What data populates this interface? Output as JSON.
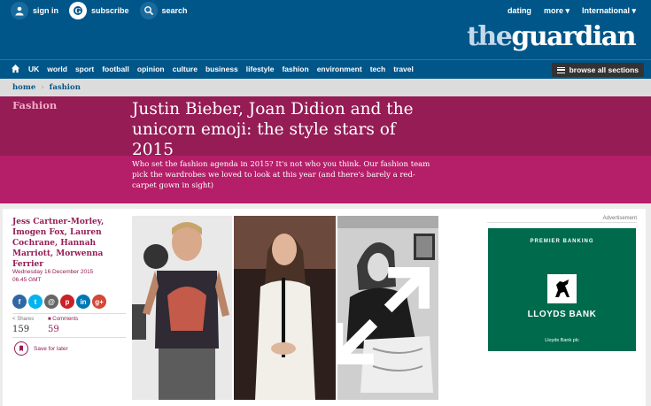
{
  "header": {
    "top_links": [
      {
        "label": "sign in",
        "icon": "user-icon"
      },
      {
        "label": "subscribe",
        "icon": "guardian-icon"
      },
      {
        "label": "search",
        "icon": "search-icon"
      }
    ],
    "right_links": [
      "dating",
      "more ▾",
      "International ▾"
    ],
    "logo": {
      "the": "the",
      "brand": "guardian"
    },
    "brand_color": "#005689"
  },
  "nav": {
    "items": [
      "UK",
      "world",
      "sport",
      "football",
      "opinion",
      "culture",
      "business",
      "lifestyle",
      "fashion",
      "environment",
      "tech",
      "travel"
    ],
    "browse_label": "browse all sections"
  },
  "breadcrumb": {
    "items": [
      "home",
      "fashion"
    ],
    "separator": "›"
  },
  "article": {
    "section": "Fashion",
    "headline": "Justin Bieber, Joan Didion and the unicorn emoji: the style stars of 2015",
    "standfirst": "Who set the fashion agenda in 2015? It's not who you think. Our fashion team pick the wardrobes we loved to look at this year (and there's barely a red-carpet gown in sight)",
    "byline": "Jess Cartner-Morley, Imogen Fox, Lauren Cochrane, Hannah Marriott, Morwenna Ferrier",
    "date": "Wednesday 16 December 2015",
    "time": "06.45 GMT",
    "share_buttons": [
      {
        "label": "f",
        "icon": "facebook-icon",
        "color": "#3067a3"
      },
      {
        "label": "t",
        "icon": "twitter-icon",
        "color": "#03b3ee"
      },
      {
        "label": "@",
        "icon": "email-icon",
        "color": "#666666"
      },
      {
        "label": "p",
        "icon": "pinterest-icon",
        "color": "#cb2027"
      },
      {
        "label": "in",
        "icon": "linkedin-icon",
        "color": "#0077b5"
      },
      {
        "label": "g+",
        "icon": "googleplus-icon",
        "color": "#d34836"
      }
    ],
    "shares_label": "Shares",
    "shares_count": "159",
    "comments_label": "Comments",
    "comments_count": "59",
    "save_label": "Save for later",
    "accent": "#951c55"
  },
  "advert": {
    "label": "Advertisement",
    "tagline": "PREMIER BANKING",
    "brand": "LLOYDS BANK",
    "footer": "Lloyds Bank plc",
    "color": "#006a4d"
  }
}
